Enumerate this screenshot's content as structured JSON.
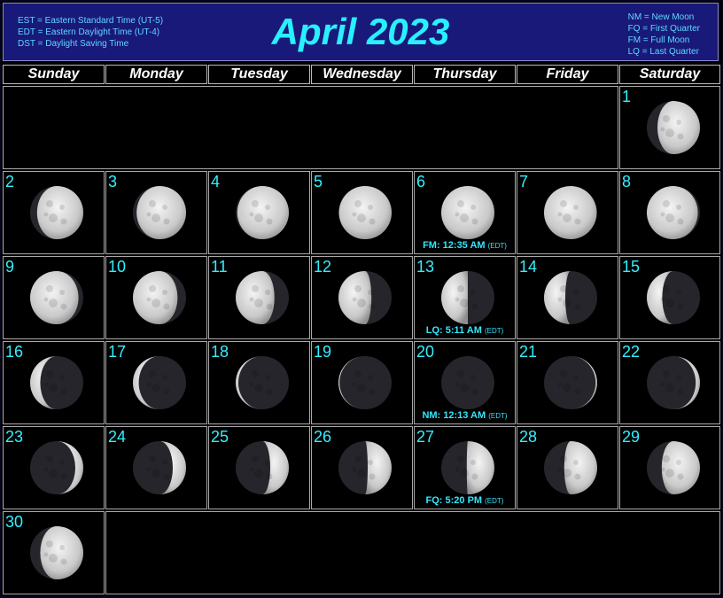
{
  "header": {
    "title": "April 2023",
    "legend_left": [
      "EST = Eastern Standard Time (UT-5)",
      "EDT = Eastern Daylight Time (UT-4)",
      "DST = Daylight Saving Time"
    ],
    "legend_right": [
      "NM = New Moon",
      "FQ = First Quarter",
      "FM = Full Moon",
      "LQ = Last Quarter"
    ]
  },
  "weekdays": [
    "Sunday",
    "Monday",
    "Tuesday",
    "Wednesday",
    "Thursday",
    "Friday",
    "Saturday"
  ],
  "first_weekday": 6,
  "days": [
    {
      "day": 1,
      "illumination": 0.8,
      "waxing": true
    },
    {
      "day": 2,
      "illumination": 0.87,
      "waxing": true
    },
    {
      "day": 3,
      "illumination": 0.93,
      "waxing": true
    },
    {
      "day": 4,
      "illumination": 0.97,
      "waxing": true
    },
    {
      "day": 5,
      "illumination": 0.99,
      "waxing": true
    },
    {
      "day": 6,
      "illumination": 1.0,
      "waxing": true,
      "event": "FM: 12:35 AM",
      "event_tz": "(EDT)"
    },
    {
      "day": 7,
      "illumination": 0.99,
      "waxing": false
    },
    {
      "day": 8,
      "illumination": 0.96,
      "waxing": false
    },
    {
      "day": 9,
      "illumination": 0.91,
      "waxing": false
    },
    {
      "day": 10,
      "illumination": 0.84,
      "waxing": false
    },
    {
      "day": 11,
      "illumination": 0.73,
      "waxing": false
    },
    {
      "day": 12,
      "illumination": 0.62,
      "waxing": false
    },
    {
      "day": 13,
      "illumination": 0.5,
      "waxing": false,
      "event": "LQ: 5:11 AM",
      "event_tz": "(EDT)"
    },
    {
      "day": 14,
      "illumination": 0.4,
      "waxing": false
    },
    {
      "day": 15,
      "illumination": 0.29,
      "waxing": false
    },
    {
      "day": 16,
      "illumination": 0.19,
      "waxing": false
    },
    {
      "day": 17,
      "illumination": 0.11,
      "waxing": false
    },
    {
      "day": 18,
      "illumination": 0.05,
      "waxing": false
    },
    {
      "day": 19,
      "illumination": 0.02,
      "waxing": false
    },
    {
      "day": 20,
      "illumination": 0.0,
      "waxing": true,
      "event": "NM: 12:13 AM",
      "event_tz": "(EDT)"
    },
    {
      "day": 21,
      "illumination": 0.03,
      "waxing": true
    },
    {
      "day": 22,
      "illumination": 0.08,
      "waxing": true
    },
    {
      "day": 23,
      "illumination": 0.15,
      "waxing": true
    },
    {
      "day": 24,
      "illumination": 0.25,
      "waxing": true
    },
    {
      "day": 25,
      "illumination": 0.35,
      "waxing": true
    },
    {
      "day": 26,
      "illumination": 0.45,
      "waxing": true
    },
    {
      "day": 27,
      "illumination": 0.52,
      "waxing": true,
      "event": "FQ: 5:20 PM",
      "event_tz": "(EDT)"
    },
    {
      "day": 28,
      "illumination": 0.62,
      "waxing": true
    },
    {
      "day": 29,
      "illumination": 0.72,
      "waxing": true
    },
    {
      "day": 30,
      "illumination": 0.81,
      "waxing": true
    }
  ],
  "colors": {
    "accent": "#33f0ff",
    "header_bg": "#19197a",
    "legend_text": "#5fd8ff"
  }
}
